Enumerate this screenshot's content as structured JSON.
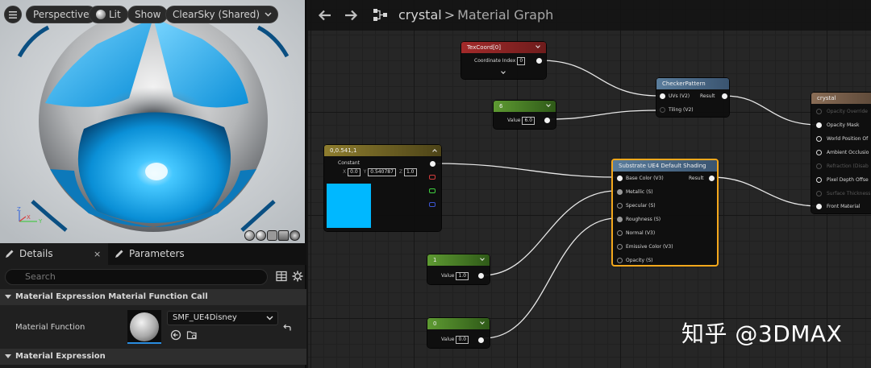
{
  "viewport": {
    "menu_icon": "hamburger-icon",
    "perspective_label": "Perspective",
    "lit_label": "Lit",
    "show_label": "Show",
    "sky_label": "ClearSky (Shared)",
    "axis_x": "X",
    "axis_y": "Y",
    "axis_z": "Z"
  },
  "details_panel": {
    "tabs": [
      {
        "label": "Details",
        "icon": "pencil-icon"
      },
      {
        "label": "Parameters",
        "icon": "pencil-icon"
      }
    ],
    "close_glyph": "×",
    "search_placeholder": "Search",
    "categories": [
      {
        "label": "Material Expression Material Function Call"
      },
      {
        "label": "Material Expression"
      }
    ],
    "material_function": {
      "label": "Material Function",
      "value": "SMF_UE4Disney"
    }
  },
  "graph": {
    "breadcrumb_asset": "crystal",
    "breadcrumb_sep": ">",
    "breadcrumb_title": "Material Graph",
    "nodes": {
      "texcoord": {
        "title": "TexCoord[0]",
        "pin_label": "Coordinate Index",
        "value": "0"
      },
      "checker": {
        "title": "CheckerPattern",
        "inputs": [
          "UVs (V2)",
          "Tiling (V2)"
        ],
        "output": "Result"
      },
      "const6": {
        "title": "6",
        "pin_label": "Value",
        "value": "6.0"
      },
      "vector": {
        "title": "0,0.541,1",
        "constant_label": "Constant",
        "x_label": "X",
        "x": "0.0",
        "y_label": "Y",
        "y": "0.540787",
        "z_label": "Z",
        "z": "1.0"
      },
      "substrate": {
        "title": "Substrate UE4 Default Shading",
        "output": "Result",
        "inputs": [
          "Base Color (V3)",
          "Metallic (S)",
          "Specular (S)",
          "Roughness (S)",
          "Normal (V3)",
          "Emissive Color (V3)",
          "Opacity (S)"
        ]
      },
      "const1": {
        "title": "1",
        "pin_label": "Value",
        "value": "1.0"
      },
      "const0": {
        "title": "0",
        "pin_label": "Value",
        "value": "0.0"
      },
      "output": {
        "title": "crystal",
        "inputs": [
          "Opacity Override",
          "Opacity Mask",
          "World Position Of",
          "Ambient Occlusio",
          "Refraction (Disab",
          "Pixel Depth Offse",
          "Surface Thickness",
          "Front Material"
        ]
      }
    }
  },
  "watermark": "知乎 @3DMAX",
  "colors": {
    "accent_selected": "#f4a81c",
    "vector_swatch": "#00b8ff",
    "header_texcoord": "#a32a2a",
    "header_checker": "#4f6f8c",
    "header_constant": "#4f8a2a",
    "header_vector": "#8a7a2a",
    "header_output": "#8a6d56"
  }
}
